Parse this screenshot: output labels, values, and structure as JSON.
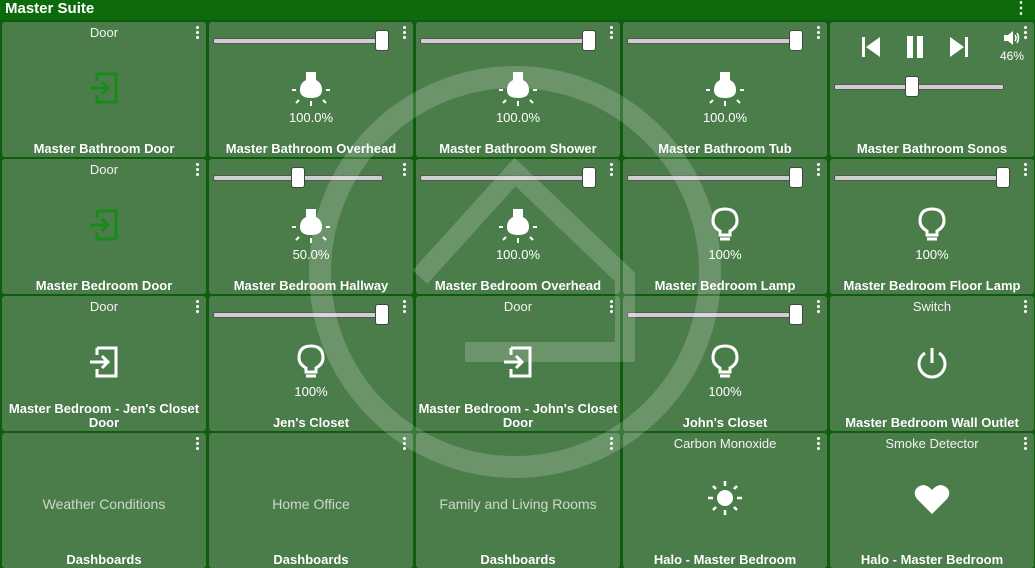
{
  "header": {
    "title": "Master Suite"
  },
  "tiles": [
    {
      "header": "Door",
      "name": "Master Bathroom Door",
      "icon": "door-exit-icon-green"
    },
    {
      "name": "Master Bathroom Overhead",
      "value": "100.0%",
      "level": 100,
      "icon": "bulb-on-icon"
    },
    {
      "name": "Master Bathroom Shower",
      "value": "100.0%",
      "level": 100,
      "icon": "bulb-on-icon"
    },
    {
      "name": "Master Bathroom Tub",
      "value": "100.0%",
      "level": 100,
      "icon": "bulb-on-icon"
    },
    {
      "name": "Master Bathroom Sonos",
      "volume": "46%",
      "volume_level": 46,
      "icon": "speaker-icon"
    },
    {
      "header": "Door",
      "name": "Master Bedroom Door",
      "icon": "door-exit-icon-green"
    },
    {
      "name": "Master Bedroom Hallway",
      "value": "50.0%",
      "level": 50,
      "icon": "bulb-on-icon"
    },
    {
      "name": "Master Bedroom Overhead",
      "value": "100.0%",
      "level": 100,
      "icon": "bulb-on-icon"
    },
    {
      "name": "Master Bedroom Lamp",
      "value": "100%",
      "level": 100,
      "icon": "bulb-outline-icon"
    },
    {
      "name": "Master Bedroom Floor Lamp",
      "value": "100%",
      "level": 100,
      "icon": "bulb-outline-icon"
    },
    {
      "header": "Door",
      "name": "Master Bedroom - Jen's Closet Door",
      "icon": "door-exit-icon"
    },
    {
      "name": "Jen's Closet",
      "value": "100%",
      "level": 100,
      "icon": "bulb-outline-icon"
    },
    {
      "header": "Door",
      "name": "Master Bedroom - John's Closet Door",
      "icon": "door-exit-icon"
    },
    {
      "name": "John's Closet",
      "value": "100%",
      "level": 100,
      "icon": "bulb-outline-icon"
    },
    {
      "header": "Switch",
      "name": "Master Bedroom Wall Outlet",
      "icon": "power-icon"
    },
    {
      "name": "Dashboards",
      "dash_label": "Weather Conditions"
    },
    {
      "name": "Dashboards",
      "dash_label": "Home Office"
    },
    {
      "name": "Dashboards",
      "dash_label": "Family and Living Rooms"
    },
    {
      "header": "Carbon Monoxide",
      "name": "Halo - Master Bedroom",
      "icon": "sun-icon"
    },
    {
      "header": "Smoke Detector",
      "name": "Halo - Master Bedroom",
      "icon": "heart-icon"
    }
  ]
}
